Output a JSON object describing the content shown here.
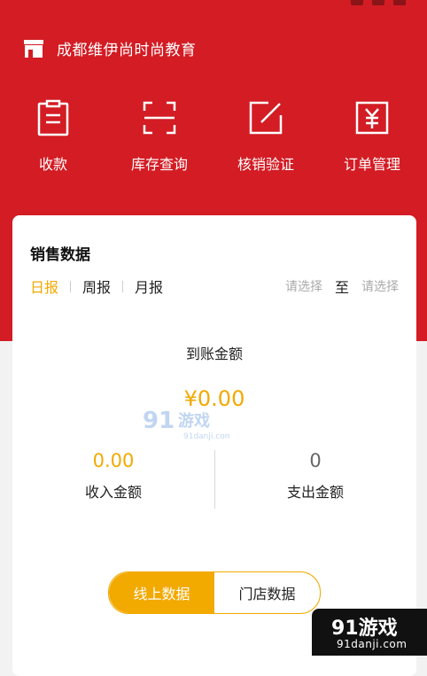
{
  "store": {
    "name": "成都维伊尚时尚教育"
  },
  "actions": [
    {
      "label": "收款",
      "icon": "clipboard-icon"
    },
    {
      "label": "库存查询",
      "icon": "scan-icon"
    },
    {
      "label": "核销验证",
      "icon": "edit-icon"
    },
    {
      "label": "订单管理",
      "icon": "yen-icon"
    }
  ],
  "sales": {
    "title": "销售数据",
    "tabs": [
      "日报",
      "周报",
      "月报"
    ],
    "active_tab": "日报",
    "date_from_placeholder": "请选择",
    "date_to_label": "至",
    "date_to_placeholder": "请选择",
    "arrival_label": "到账金额",
    "arrival_amount": "¥0.00",
    "income_value": "0.00",
    "income_label": "收入金额",
    "expense_value": "0",
    "expense_label": "支出金额",
    "source_tabs": [
      "线上数据",
      "门店数据"
    ],
    "active_source": "线上数据"
  },
  "watermark": {
    "title": "91游戏",
    "subtitle": "91danji.com"
  },
  "colors": {
    "primary_red": "#d31c24",
    "accent_yellow": "#f2a900"
  }
}
